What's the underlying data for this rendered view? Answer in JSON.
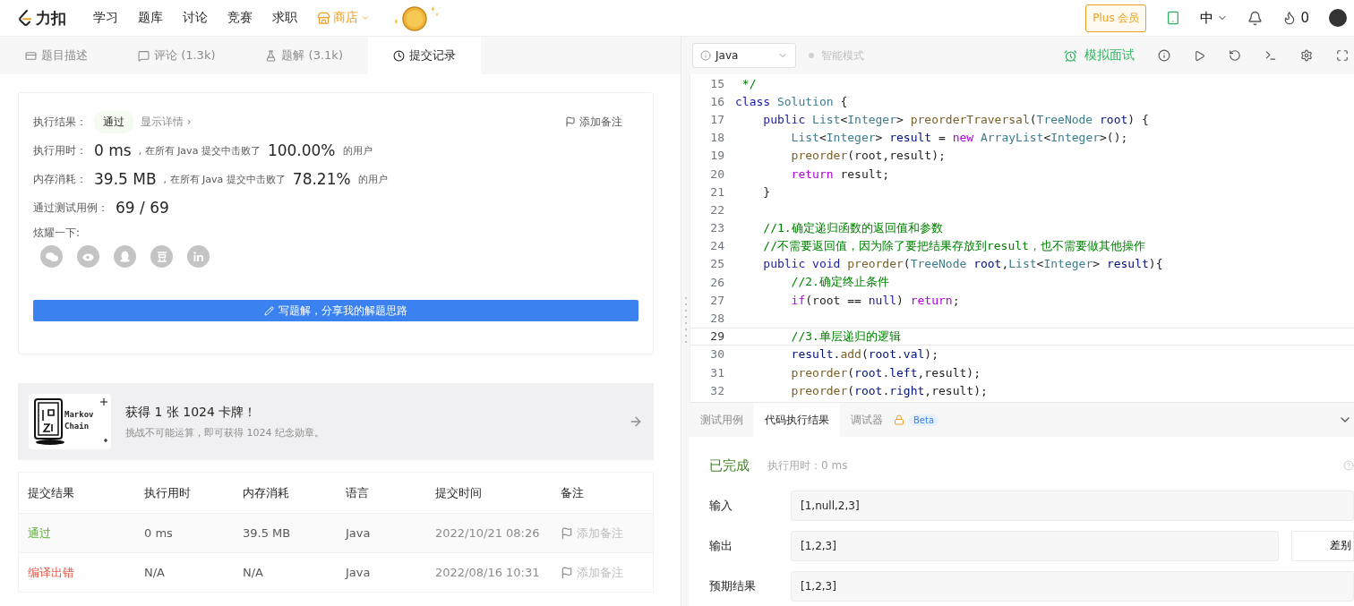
{
  "nav": {
    "logo": "力扣",
    "items": [
      {
        "label": "学习",
        "kind": "link"
      },
      {
        "label": "题库",
        "kind": "link"
      },
      {
        "label": "讨论",
        "kind": "link"
      },
      {
        "label": "竞赛",
        "kind": "link"
      },
      {
        "label": "求职",
        "kind": "link"
      },
      {
        "label": "商店",
        "kind": "shop"
      }
    ],
    "plus": "Plus 会员",
    "lang": "中",
    "points": "0"
  },
  "left_tabs": [
    {
      "label": "题目描述",
      "selected": false
    },
    {
      "label": "评论 (1.3k)",
      "selected": false
    },
    {
      "label": "题解 (3.1k)",
      "selected": false
    },
    {
      "label": "提交记录",
      "selected": true
    }
  ],
  "result_card": {
    "result_label": "执行结果：",
    "result_badge": "通过",
    "details_link": "显示详情 ›",
    "add_note": "添加备注",
    "stats": [
      {
        "label": "执行用时：",
        "value": "0 ms",
        "middle": ", 在所有 Java 提交中击败了",
        "percent": "100.00%",
        "suffix": "的用户"
      },
      {
        "label": "内存消耗：",
        "value": "39.5 MB",
        "middle": ", 在所有 Java 提交中击败了",
        "percent": "78.21%",
        "suffix": "的用户"
      }
    ],
    "tests_label": "通过测试用例：",
    "tests_value": "69 / 69",
    "share_label": "炫耀一下:",
    "write_button": "写题解，分享我的解题思路"
  },
  "banner": {
    "card_words": [
      "Markov",
      "Chain"
    ],
    "title": "获得 1 张 1024 卡牌！",
    "subtitle": "挑战不可能运算，即可获得 1024 纪念勋章。"
  },
  "submissions": {
    "columns": [
      "提交结果",
      "执行用时",
      "内存消耗",
      "语言",
      "提交时间",
      "备注"
    ],
    "rows": [
      {
        "status": "通过",
        "kind": "accepted",
        "runtime": "0 ms",
        "memory": "39.5 MB",
        "language": "Java",
        "time": "2022/10/21 08:26",
        "note": "添加备注"
      },
      {
        "status": "编译出错",
        "kind": "error",
        "runtime": "N/A",
        "memory": "N/A",
        "language": "Java",
        "time": "2022/08/16 10:31",
        "note": "添加备注"
      }
    ]
  },
  "editor": {
    "language": "Java",
    "smart_mode": "智能模式",
    "mock_interview": "模拟面试",
    "lines": [
      {
        "n": "15",
        "current": false,
        "tokens": [
          {
            "t": " */",
            "kind": "comment"
          }
        ]
      },
      {
        "n": "16",
        "current": false,
        "tokens": [
          {
            "t": "class ",
            "kind": "kw"
          },
          {
            "t": "Solution",
            "kind": "type"
          },
          {
            "t": " {",
            "kind": "p"
          }
        ]
      },
      {
        "n": "17",
        "current": false,
        "tokens": [
          {
            "t": "    public ",
            "kind": "kw"
          },
          {
            "t": "List",
            "kind": "type"
          },
          {
            "t": "<",
            "kind": "p"
          },
          {
            "t": "Integer",
            "kind": "type"
          },
          {
            "t": "> ",
            "kind": "p"
          },
          {
            "t": "preorderTraversal",
            "kind": "fn"
          },
          {
            "t": "(",
            "kind": "p"
          },
          {
            "t": "TreeNode",
            "kind": "type"
          },
          {
            "t": " root",
            "kind": "id"
          },
          {
            "t": ") {",
            "kind": "p"
          }
        ]
      },
      {
        "n": "18",
        "current": false,
        "tokens": [
          {
            "t": "        List",
            "kind": "type"
          },
          {
            "t": "<",
            "kind": "p"
          },
          {
            "t": "Integer",
            "kind": "type"
          },
          {
            "t": "> ",
            "kind": "p"
          },
          {
            "t": "result",
            "kind": "id"
          },
          {
            "t": " = ",
            "kind": "p"
          },
          {
            "t": "new ",
            "kind": "ctl"
          },
          {
            "t": "ArrayList",
            "kind": "type"
          },
          {
            "t": "<",
            "kind": "p"
          },
          {
            "t": "Integer",
            "kind": "type"
          },
          {
            "t": ">();",
            "kind": "p"
          }
        ]
      },
      {
        "n": "19",
        "current": false,
        "tokens": [
          {
            "t": "        preorder",
            "kind": "fn"
          },
          {
            "t": "(root,result);",
            "kind": "p"
          }
        ]
      },
      {
        "n": "20",
        "current": false,
        "tokens": [
          {
            "t": "        return",
            "kind": "ctl"
          },
          {
            "t": " result;",
            "kind": "p"
          }
        ]
      },
      {
        "n": "21",
        "current": false,
        "tokens": [
          {
            "t": "    }",
            "kind": "p"
          }
        ]
      },
      {
        "n": "22",
        "current": false
      },
      {
        "n": "23",
        "current": false,
        "tokens": [
          {
            "t": "    //1.确定递归函数的返回值和参数",
            "kind": "comment"
          }
        ]
      },
      {
        "n": "24",
        "current": false,
        "tokens": [
          {
            "t": "    //不需要返回值，因为除了要把结果存放到result，也不需要做其他操作",
            "kind": "comment"
          }
        ]
      },
      {
        "n": "25",
        "current": false,
        "tokens": [
          {
            "t": "    public void ",
            "kind": "kw"
          },
          {
            "t": "preorder",
            "kind": "fn"
          },
          {
            "t": "(",
            "kind": "p"
          },
          {
            "t": "TreeNode",
            "kind": "type"
          },
          {
            "t": " root",
            "kind": "id"
          },
          {
            "t": ",",
            "kind": "p"
          },
          {
            "t": "List",
            "kind": "type"
          },
          {
            "t": "<",
            "kind": "p"
          },
          {
            "t": "Integer",
            "kind": "type"
          },
          {
            "t": "> ",
            "kind": "p"
          },
          {
            "t": "result",
            "kind": "id"
          },
          {
            "t": "){",
            "kind": "p"
          }
        ]
      },
      {
        "n": "26",
        "current": false,
        "tokens": [
          {
            "t": "        //2.确定终止条件",
            "kind": "comment"
          }
        ]
      },
      {
        "n": "27",
        "current": false,
        "tokens": [
          {
            "t": "        if",
            "kind": "ctl"
          },
          {
            "t": "(root == ",
            "kind": "p"
          },
          {
            "t": "null",
            "kind": "kw"
          },
          {
            "t": ") ",
            "kind": "p"
          },
          {
            "t": "return",
            "kind": "ctl"
          },
          {
            "t": ";",
            "kind": "p"
          }
        ]
      },
      {
        "n": "28",
        "current": false
      },
      {
        "n": "29",
        "current": true,
        "tokens": [
          {
            "t": "        //3.单层递归的逻辑",
            "kind": "comment"
          }
        ]
      },
      {
        "n": "30",
        "current": false,
        "tokens": [
          {
            "t": "        result",
            "kind": "id"
          },
          {
            "t": ".",
            "kind": "p"
          },
          {
            "t": "add",
            "kind": "fn"
          },
          {
            "t": "(",
            "kind": "p"
          },
          {
            "t": "root",
            "kind": "id"
          },
          {
            "t": ".",
            "kind": "p"
          },
          {
            "t": "val",
            "kind": "id"
          },
          {
            "t": ");",
            "kind": "p"
          }
        ]
      },
      {
        "n": "31",
        "current": false,
        "tokens": [
          {
            "t": "        preorder",
            "kind": "fn"
          },
          {
            "t": "(",
            "kind": "p"
          },
          {
            "t": "root",
            "kind": "id"
          },
          {
            "t": ".",
            "kind": "p"
          },
          {
            "t": "left",
            "kind": "id"
          },
          {
            "t": ",result);",
            "kind": "p"
          }
        ]
      },
      {
        "n": "32",
        "current": false,
        "tokens": [
          {
            "t": "        preorder",
            "kind": "fn"
          },
          {
            "t": "(",
            "kind": "p"
          },
          {
            "t": "root",
            "kind": "id"
          },
          {
            "t": ".",
            "kind": "p"
          },
          {
            "t": "right",
            "kind": "id"
          },
          {
            "t": ",result);",
            "kind": "p"
          }
        ]
      }
    ]
  },
  "console": {
    "tabs": [
      {
        "label": "测试用例",
        "selected": false
      },
      {
        "label": "代码执行结果",
        "selected": true
      },
      {
        "label": "调试器",
        "selected": false
      }
    ],
    "beta": "Beta",
    "status": "已完成",
    "runtime": "执行用时：0 ms",
    "fields": [
      {
        "label": "输入",
        "value": "[1,null,2,3]"
      },
      {
        "label": "输出",
        "value": "[1,2,3]"
      },
      {
        "label": "预期结果",
        "value": "[1,2,3]"
      }
    ],
    "diff": "差别"
  }
}
